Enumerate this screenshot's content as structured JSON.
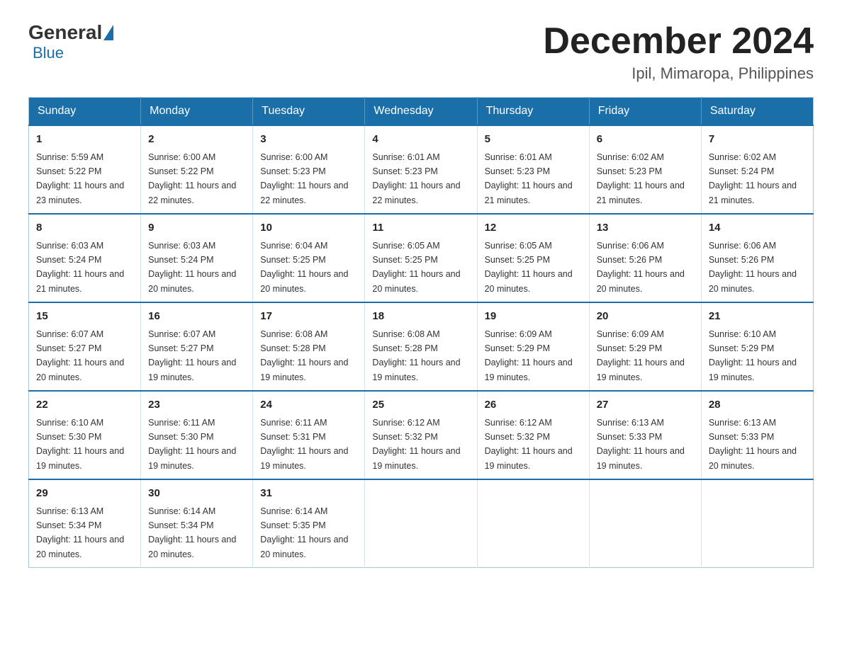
{
  "header": {
    "logo": {
      "general": "General",
      "blue": "Blue"
    },
    "month": "December 2024",
    "location": "Ipil, Mimaropa, Philippines"
  },
  "weekdays": [
    "Sunday",
    "Monday",
    "Tuesday",
    "Wednesday",
    "Thursday",
    "Friday",
    "Saturday"
  ],
  "weeks": [
    [
      {
        "day": "1",
        "sunrise": "Sunrise: 5:59 AM",
        "sunset": "Sunset: 5:22 PM",
        "daylight": "Daylight: 11 hours and 23 minutes."
      },
      {
        "day": "2",
        "sunrise": "Sunrise: 6:00 AM",
        "sunset": "Sunset: 5:22 PM",
        "daylight": "Daylight: 11 hours and 22 minutes."
      },
      {
        "day": "3",
        "sunrise": "Sunrise: 6:00 AM",
        "sunset": "Sunset: 5:23 PM",
        "daylight": "Daylight: 11 hours and 22 minutes."
      },
      {
        "day": "4",
        "sunrise": "Sunrise: 6:01 AM",
        "sunset": "Sunset: 5:23 PM",
        "daylight": "Daylight: 11 hours and 22 minutes."
      },
      {
        "day": "5",
        "sunrise": "Sunrise: 6:01 AM",
        "sunset": "Sunset: 5:23 PM",
        "daylight": "Daylight: 11 hours and 21 minutes."
      },
      {
        "day": "6",
        "sunrise": "Sunrise: 6:02 AM",
        "sunset": "Sunset: 5:23 PM",
        "daylight": "Daylight: 11 hours and 21 minutes."
      },
      {
        "day": "7",
        "sunrise": "Sunrise: 6:02 AM",
        "sunset": "Sunset: 5:24 PM",
        "daylight": "Daylight: 11 hours and 21 minutes."
      }
    ],
    [
      {
        "day": "8",
        "sunrise": "Sunrise: 6:03 AM",
        "sunset": "Sunset: 5:24 PM",
        "daylight": "Daylight: 11 hours and 21 minutes."
      },
      {
        "day": "9",
        "sunrise": "Sunrise: 6:03 AM",
        "sunset": "Sunset: 5:24 PM",
        "daylight": "Daylight: 11 hours and 20 minutes."
      },
      {
        "day": "10",
        "sunrise": "Sunrise: 6:04 AM",
        "sunset": "Sunset: 5:25 PM",
        "daylight": "Daylight: 11 hours and 20 minutes."
      },
      {
        "day": "11",
        "sunrise": "Sunrise: 6:05 AM",
        "sunset": "Sunset: 5:25 PM",
        "daylight": "Daylight: 11 hours and 20 minutes."
      },
      {
        "day": "12",
        "sunrise": "Sunrise: 6:05 AM",
        "sunset": "Sunset: 5:25 PM",
        "daylight": "Daylight: 11 hours and 20 minutes."
      },
      {
        "day": "13",
        "sunrise": "Sunrise: 6:06 AM",
        "sunset": "Sunset: 5:26 PM",
        "daylight": "Daylight: 11 hours and 20 minutes."
      },
      {
        "day": "14",
        "sunrise": "Sunrise: 6:06 AM",
        "sunset": "Sunset: 5:26 PM",
        "daylight": "Daylight: 11 hours and 20 minutes."
      }
    ],
    [
      {
        "day": "15",
        "sunrise": "Sunrise: 6:07 AM",
        "sunset": "Sunset: 5:27 PM",
        "daylight": "Daylight: 11 hours and 20 minutes."
      },
      {
        "day": "16",
        "sunrise": "Sunrise: 6:07 AM",
        "sunset": "Sunset: 5:27 PM",
        "daylight": "Daylight: 11 hours and 19 minutes."
      },
      {
        "day": "17",
        "sunrise": "Sunrise: 6:08 AM",
        "sunset": "Sunset: 5:28 PM",
        "daylight": "Daylight: 11 hours and 19 minutes."
      },
      {
        "day": "18",
        "sunrise": "Sunrise: 6:08 AM",
        "sunset": "Sunset: 5:28 PM",
        "daylight": "Daylight: 11 hours and 19 minutes."
      },
      {
        "day": "19",
        "sunrise": "Sunrise: 6:09 AM",
        "sunset": "Sunset: 5:29 PM",
        "daylight": "Daylight: 11 hours and 19 minutes."
      },
      {
        "day": "20",
        "sunrise": "Sunrise: 6:09 AM",
        "sunset": "Sunset: 5:29 PM",
        "daylight": "Daylight: 11 hours and 19 minutes."
      },
      {
        "day": "21",
        "sunrise": "Sunrise: 6:10 AM",
        "sunset": "Sunset: 5:29 PM",
        "daylight": "Daylight: 11 hours and 19 minutes."
      }
    ],
    [
      {
        "day": "22",
        "sunrise": "Sunrise: 6:10 AM",
        "sunset": "Sunset: 5:30 PM",
        "daylight": "Daylight: 11 hours and 19 minutes."
      },
      {
        "day": "23",
        "sunrise": "Sunrise: 6:11 AM",
        "sunset": "Sunset: 5:30 PM",
        "daylight": "Daylight: 11 hours and 19 minutes."
      },
      {
        "day": "24",
        "sunrise": "Sunrise: 6:11 AM",
        "sunset": "Sunset: 5:31 PM",
        "daylight": "Daylight: 11 hours and 19 minutes."
      },
      {
        "day": "25",
        "sunrise": "Sunrise: 6:12 AM",
        "sunset": "Sunset: 5:32 PM",
        "daylight": "Daylight: 11 hours and 19 minutes."
      },
      {
        "day": "26",
        "sunrise": "Sunrise: 6:12 AM",
        "sunset": "Sunset: 5:32 PM",
        "daylight": "Daylight: 11 hours and 19 minutes."
      },
      {
        "day": "27",
        "sunrise": "Sunrise: 6:13 AM",
        "sunset": "Sunset: 5:33 PM",
        "daylight": "Daylight: 11 hours and 19 minutes."
      },
      {
        "day": "28",
        "sunrise": "Sunrise: 6:13 AM",
        "sunset": "Sunset: 5:33 PM",
        "daylight": "Daylight: 11 hours and 20 minutes."
      }
    ],
    [
      {
        "day": "29",
        "sunrise": "Sunrise: 6:13 AM",
        "sunset": "Sunset: 5:34 PM",
        "daylight": "Daylight: 11 hours and 20 minutes."
      },
      {
        "day": "30",
        "sunrise": "Sunrise: 6:14 AM",
        "sunset": "Sunset: 5:34 PM",
        "daylight": "Daylight: 11 hours and 20 minutes."
      },
      {
        "day": "31",
        "sunrise": "Sunrise: 6:14 AM",
        "sunset": "Sunset: 5:35 PM",
        "daylight": "Daylight: 11 hours and 20 minutes."
      },
      null,
      null,
      null,
      null
    ]
  ]
}
